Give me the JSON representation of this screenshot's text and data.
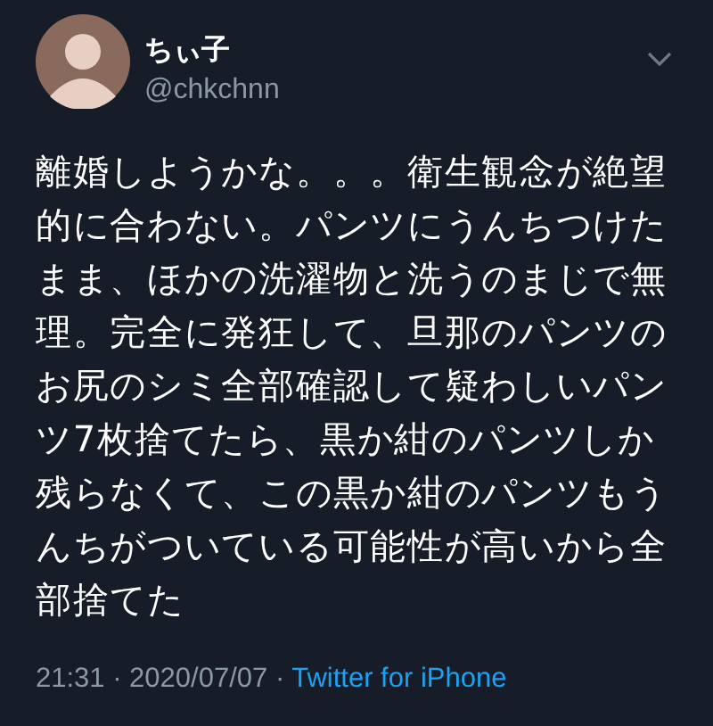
{
  "author": {
    "name": "ちぃ子",
    "handle": "@chkchnn"
  },
  "tweet": {
    "text": "離婚しようかな。。。衛生観念が絶望的に合わない。パンツにうんちつけたまま、ほかの洗濯物と洗うのまじで無理。完全に発狂して、旦那のパンツのお尻のシミ全部確認して疑わしいパンツ7枚捨てたら、黒か紺のパンツしか残らなくて、この黒か紺のパンツもうんちがついている可能性が高いから全部捨てた"
  },
  "meta": {
    "time": "21:31 · 2020/07/07 ·",
    "source": "Twitter for iPhone"
  }
}
